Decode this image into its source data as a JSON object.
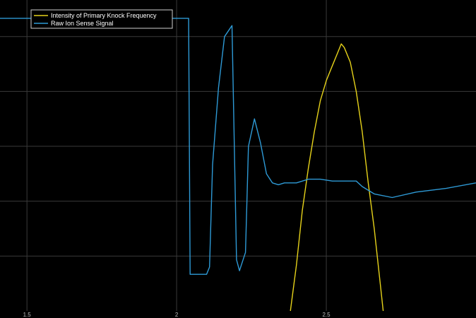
{
  "chart_data": {
    "type": "line",
    "title": "",
    "xlabel": "",
    "ylabel": "",
    "xlim": [
      1.41,
      3.0
    ],
    "ylim": [
      -0.6,
      1.1
    ],
    "grid": true,
    "legend_position": "top-left",
    "x_ticks": [
      1.5,
      2.0,
      2.5
    ],
    "x_tick_labels": [
      "1.5",
      "2",
      "2.5"
    ],
    "y_ticks": [
      -0.3,
      0.0,
      0.3,
      0.6,
      0.9
    ],
    "background_color": "#000000",
    "grid_color": "#3a3a3a",
    "series": [
      {
        "name": "Intensity of Primary Knock Frequency",
        "color": "#e6d21a",
        "x": [
          2.38,
          2.4,
          2.42,
          2.44,
          2.46,
          2.48,
          2.5,
          2.52,
          2.54,
          2.55,
          2.56,
          2.58,
          2.6,
          2.62,
          2.64,
          2.66,
          2.68,
          2.69
        ],
        "y": [
          -0.6,
          -0.35,
          -0.05,
          0.18,
          0.38,
          0.55,
          0.66,
          0.74,
          0.82,
          0.86,
          0.84,
          0.76,
          0.6,
          0.38,
          0.1,
          -0.15,
          -0.45,
          -0.6
        ]
      },
      {
        "name": "Raw Ion Sense Signal",
        "color": "#2e9ad6",
        "x": [
          1.41,
          1.5,
          1.6,
          1.7,
          1.8,
          1.9,
          2.0,
          2.04,
          2.045,
          2.06,
          2.08,
          2.1,
          2.11,
          2.12,
          2.14,
          2.16,
          2.185,
          2.2,
          2.21,
          2.23,
          2.24,
          2.26,
          2.28,
          2.3,
          2.32,
          2.34,
          2.36,
          2.4,
          2.44,
          2.48,
          2.52,
          2.56,
          2.6,
          2.62,
          2.66,
          2.72,
          2.8,
          2.9,
          3.0
        ],
        "y": [
          1.0,
          1.0,
          1.0,
          0.99,
          1.0,
          1.0,
          1.0,
          1.0,
          -0.4,
          -0.4,
          -0.4,
          -0.4,
          -0.36,
          0.2,
          0.62,
          0.9,
          0.96,
          -0.32,
          -0.38,
          -0.28,
          0.3,
          0.45,
          0.32,
          0.15,
          0.1,
          0.09,
          0.1,
          0.1,
          0.12,
          0.12,
          0.11,
          0.11,
          0.11,
          0.08,
          0.04,
          0.02,
          0.05,
          0.07,
          0.1
        ]
      }
    ]
  }
}
